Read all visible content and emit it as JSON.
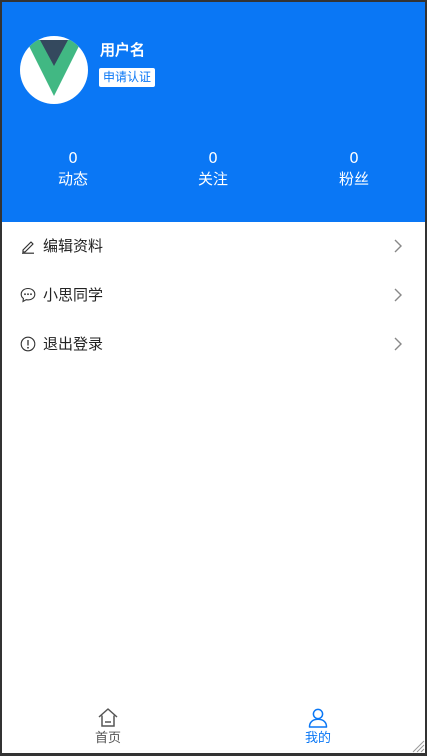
{
  "profile": {
    "username": "用户名",
    "verify_label": "申请认证",
    "avatar_icon": "vue-logo-icon"
  },
  "stats": [
    {
      "value": "0",
      "label": "动态"
    },
    {
      "value": "0",
      "label": "关注"
    },
    {
      "value": "0",
      "label": "粉丝"
    }
  ],
  "menu": [
    {
      "icon": "edit-icon",
      "label": "编辑资料"
    },
    {
      "icon": "chat-icon",
      "label": "小思同学"
    },
    {
      "icon": "alert-icon",
      "label": "退出登录"
    }
  ],
  "tabbar": {
    "home_label": "首页",
    "mine_label": "我的"
  },
  "colors": {
    "primary": "#0a77f5",
    "text": "#222222",
    "chevron": "#888888"
  }
}
